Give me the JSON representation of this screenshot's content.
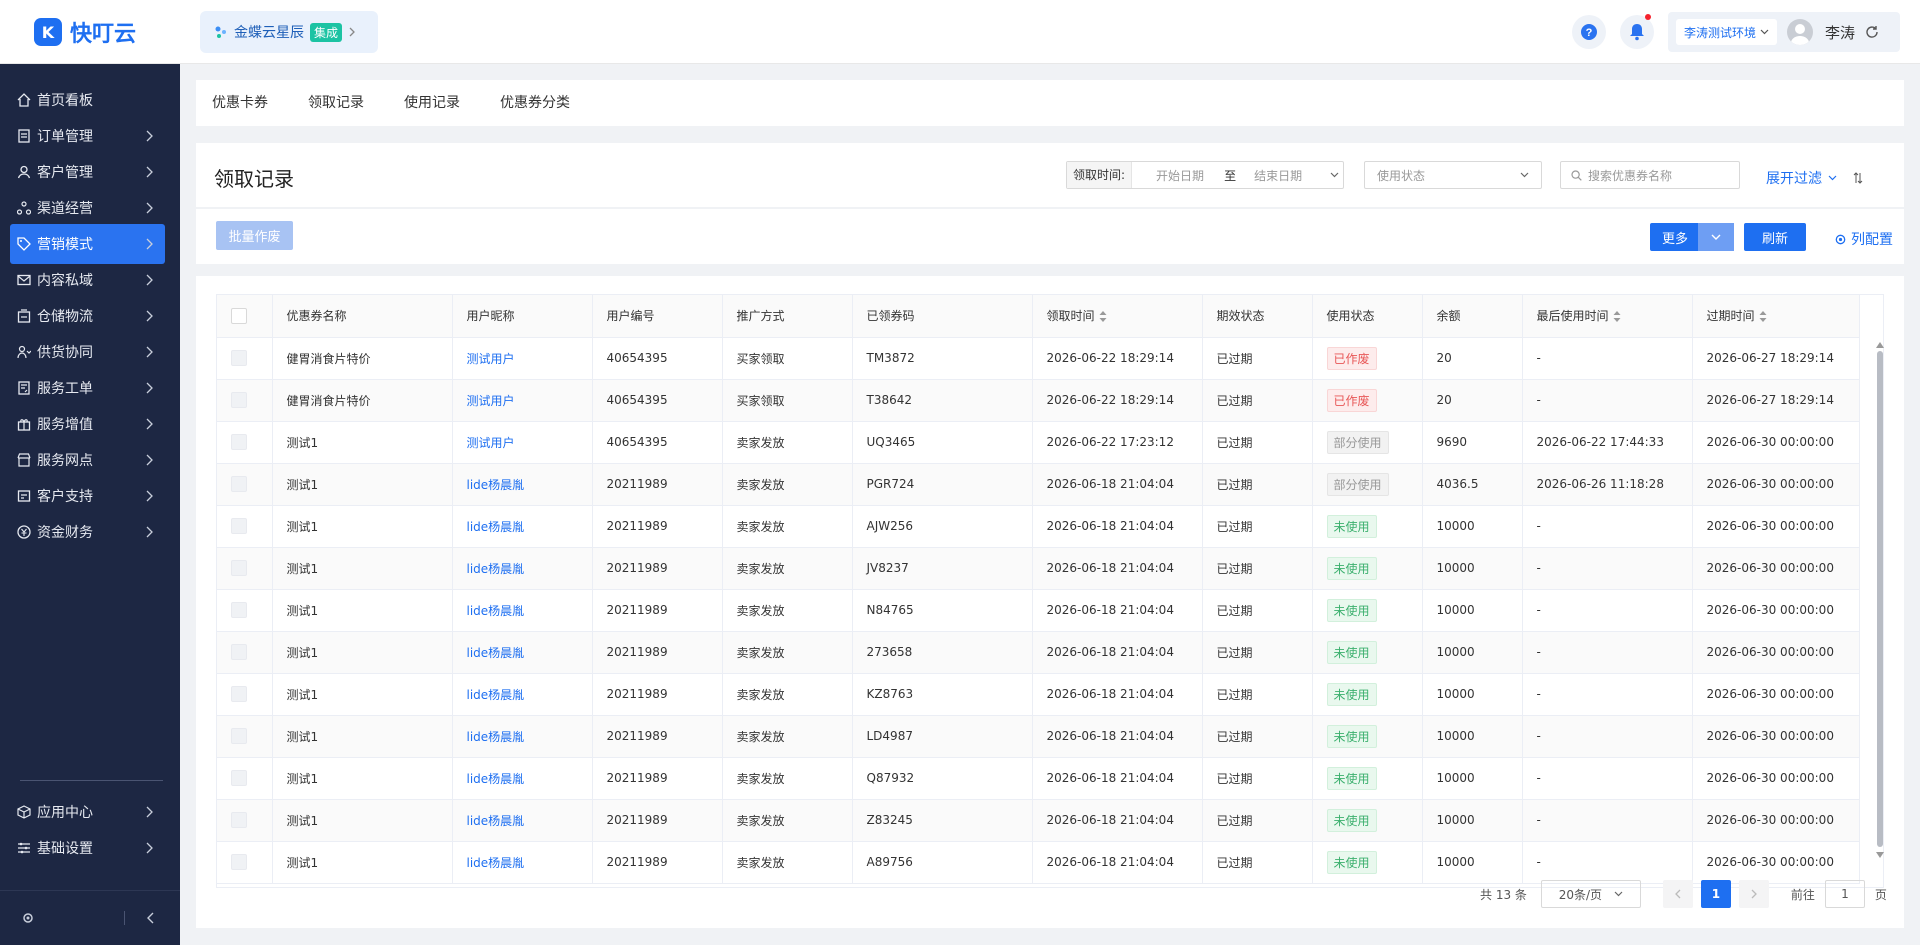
{
  "app": {
    "logo_text": "快叮云",
    "integration_name": "金蝶云星辰",
    "integration_badge": "集成",
    "environment": "李涛测试环境",
    "user_name": "李涛"
  },
  "sidebar": {
    "items": [
      {
        "label": "首页看板",
        "icon": "home-icon",
        "has_arrow": false,
        "active": false
      },
      {
        "label": "订单管理",
        "icon": "order-icon",
        "has_arrow": true,
        "active": false
      },
      {
        "label": "客户管理",
        "icon": "user-icon",
        "has_arrow": true,
        "active": false
      },
      {
        "label": "渠道经营",
        "icon": "channel-icon",
        "has_arrow": true,
        "active": false
      },
      {
        "label": "营销模式",
        "icon": "tag-icon",
        "has_arrow": true,
        "active": true
      },
      {
        "label": "内容私域",
        "icon": "mail-icon",
        "has_arrow": true,
        "active": false
      },
      {
        "label": "仓储物流",
        "icon": "warehouse-icon",
        "has_arrow": true,
        "active": false
      },
      {
        "label": "供货协同",
        "icon": "supply-icon",
        "has_arrow": true,
        "active": false
      },
      {
        "label": "服务工单",
        "icon": "ticket-icon",
        "has_arrow": true,
        "active": false
      },
      {
        "label": "服务增值",
        "icon": "gift-icon",
        "has_arrow": true,
        "active": false
      },
      {
        "label": "服务网点",
        "icon": "store-icon",
        "has_arrow": true,
        "active": false
      },
      {
        "label": "客户支持",
        "icon": "support-icon",
        "has_arrow": true,
        "active": false
      },
      {
        "label": "资金财务",
        "icon": "finance-icon",
        "has_arrow": true,
        "active": false
      }
    ],
    "bottom_items": [
      {
        "label": "应用中心",
        "icon": "cube-icon"
      },
      {
        "label": "基础设置",
        "icon": "settings-icon"
      }
    ]
  },
  "tabs": [
    "优惠卡券",
    "领取记录",
    "使用记录",
    "优惠券分类"
  ],
  "page": {
    "title": "领取记录"
  },
  "filters": {
    "date_label": "领取时间:",
    "start_placeholder": "开始日期",
    "separator": "至",
    "end_placeholder": "结束日期",
    "status_placeholder": "使用状态",
    "search_placeholder": "搜索优惠券名称",
    "expand_label": "展开过滤"
  },
  "toolbar": {
    "batch_void": "批量作废",
    "more": "更多",
    "refresh": "刷新",
    "column_config": "列配置"
  },
  "table": {
    "columns": [
      "优惠券名称",
      "用户昵称",
      "用户编号",
      "推广方式",
      "已领券码",
      "领取时间",
      "期效状态",
      "使用状态",
      "余额",
      "最后使用时间",
      "过期时间"
    ],
    "rows": [
      {
        "name": "健胃消食片特价",
        "nick": "测试用户",
        "uid": "40654395",
        "method": "买家领取",
        "code": "TM3872",
        "time": "2026-06-22 18:29:14",
        "validity": "已过期",
        "status": "已作废",
        "status_type": "red",
        "balance": "20",
        "last_used": "-",
        "expire": "2026-06-27 18:29:14"
      },
      {
        "name": "健胃消食片特价",
        "nick": "测试用户",
        "uid": "40654395",
        "method": "买家领取",
        "code": "T38642",
        "time": "2026-06-22 18:29:14",
        "validity": "已过期",
        "status": "已作废",
        "status_type": "red",
        "balance": "20",
        "last_used": "-",
        "expire": "2026-06-27 18:29:14"
      },
      {
        "name": "测试1",
        "nick": "测试用户",
        "uid": "40654395",
        "method": "卖家发放",
        "code": "UQ3465",
        "time": "2026-06-22 17:23:12",
        "validity": "已过期",
        "status": "部分使用",
        "status_type": "gray",
        "balance": "9690",
        "last_used": "2026-06-22 17:44:33",
        "expire": "2026-06-30 00:00:00"
      },
      {
        "name": "测试1",
        "nick": "lide杨晨胤",
        "uid": "20211989",
        "method": "卖家发放",
        "code": "PGR724",
        "time": "2026-06-18 21:04:04",
        "validity": "已过期",
        "status": "部分使用",
        "status_type": "gray",
        "balance": "4036.5",
        "last_used": "2026-06-26 11:18:28",
        "expire": "2026-06-30 00:00:00"
      },
      {
        "name": "测试1",
        "nick": "lide杨晨胤",
        "uid": "20211989",
        "method": "卖家发放",
        "code": "AJW256",
        "time": "2026-06-18 21:04:04",
        "validity": "已过期",
        "status": "未使用",
        "status_type": "green",
        "balance": "10000",
        "last_used": "-",
        "expire": "2026-06-30 00:00:00"
      },
      {
        "name": "测试1",
        "nick": "lide杨晨胤",
        "uid": "20211989",
        "method": "卖家发放",
        "code": "JV8237",
        "time": "2026-06-18 21:04:04",
        "validity": "已过期",
        "status": "未使用",
        "status_type": "green",
        "balance": "10000",
        "last_used": "-",
        "expire": "2026-06-30 00:00:00"
      },
      {
        "name": "测试1",
        "nick": "lide杨晨胤",
        "uid": "20211989",
        "method": "卖家发放",
        "code": "N84765",
        "time": "2026-06-18 21:04:04",
        "validity": "已过期",
        "status": "未使用",
        "status_type": "green",
        "balance": "10000",
        "last_used": "-",
        "expire": "2026-06-30 00:00:00"
      },
      {
        "name": "测试1",
        "nick": "lide杨晨胤",
        "uid": "20211989",
        "method": "卖家发放",
        "code": "273658",
        "time": "2026-06-18 21:04:04",
        "validity": "已过期",
        "status": "未使用",
        "status_type": "green",
        "balance": "10000",
        "last_used": "-",
        "expire": "2026-06-30 00:00:00"
      },
      {
        "name": "测试1",
        "nick": "lide杨晨胤",
        "uid": "20211989",
        "method": "卖家发放",
        "code": "KZ8763",
        "time": "2026-06-18 21:04:04",
        "validity": "已过期",
        "status": "未使用",
        "status_type": "green",
        "balance": "10000",
        "last_used": "-",
        "expire": "2026-06-30 00:00:00"
      },
      {
        "name": "测试1",
        "nick": "lide杨晨胤",
        "uid": "20211989",
        "method": "卖家发放",
        "code": "LD4987",
        "time": "2026-06-18 21:04:04",
        "validity": "已过期",
        "status": "未使用",
        "status_type": "green",
        "balance": "10000",
        "last_used": "-",
        "expire": "2026-06-30 00:00:00"
      },
      {
        "name": "测试1",
        "nick": "lide杨晨胤",
        "uid": "20211989",
        "method": "卖家发放",
        "code": "Q87932",
        "time": "2026-06-18 21:04:04",
        "validity": "已过期",
        "status": "未使用",
        "status_type": "green",
        "balance": "10000",
        "last_used": "-",
        "expire": "2026-06-30 00:00:00"
      },
      {
        "name": "测试1",
        "nick": "lide杨晨胤",
        "uid": "20211989",
        "method": "卖家发放",
        "code": "Z83245",
        "time": "2026-06-18 21:04:04",
        "validity": "已过期",
        "status": "未使用",
        "status_type": "green",
        "balance": "10000",
        "last_used": "-",
        "expire": "2026-06-30 00:00:00"
      },
      {
        "name": "测试1",
        "nick": "lide杨晨胤",
        "uid": "20211989",
        "method": "卖家发放",
        "code": "A89756",
        "time": "2026-06-18 21:04:04",
        "validity": "已过期",
        "status": "未使用",
        "status_type": "green",
        "balance": "10000",
        "last_used": "-",
        "expire": "2026-06-30 00:00:00"
      }
    ]
  },
  "pagination": {
    "total": "共 13 条",
    "page_size": "20条/页",
    "current_page": "1",
    "goto_label": "前往",
    "goto_value": "1",
    "page_suffix": "页"
  }
}
